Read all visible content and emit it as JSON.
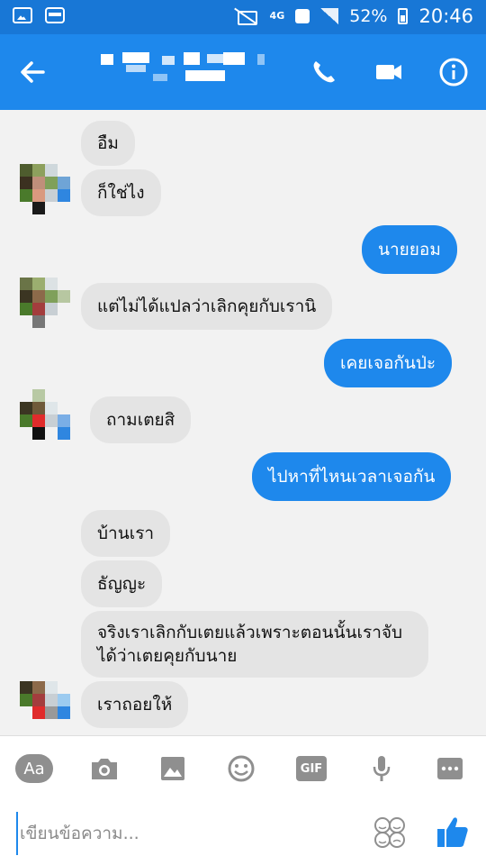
{
  "status_bar": {
    "network": "4G",
    "battery": "52%",
    "time": "20:46"
  },
  "header": {
    "back_icon": "arrow-left-icon",
    "call_icon": "phone-icon",
    "video_icon": "video-camera-icon",
    "info_icon": "info-icon"
  },
  "messages": [
    {
      "side": "in",
      "text": "อืม"
    },
    {
      "side": "in",
      "text": "ก็ใช่ไง"
    },
    {
      "side": "out",
      "text": "นายยอม"
    },
    {
      "side": "in",
      "text": "แต่ไม่ได้แปลว่าเลิกคุยกับเรานิ"
    },
    {
      "side": "out",
      "text": "เคยเจอกันป่ะ"
    },
    {
      "side": "in",
      "text": "ถามเตยสิ"
    },
    {
      "side": "out",
      "text": "ไปหาที่ไหนเวลาเจอกัน"
    },
    {
      "side": "in",
      "text": "บ้านเรา"
    },
    {
      "side": "in",
      "text": "ธัญญะ"
    },
    {
      "side": "in",
      "text": "จริงเราเลิกกับเตยแล้วเพราะตอนนั้นเราจับ"
    },
    {
      "side": "in",
      "text": "ได้ว่าเตยคุยกับนาย"
    },
    {
      "side": "in",
      "text": "เราถอยให้"
    }
  ],
  "composer": {
    "aa_label": "Aa",
    "gif_label": "GIF",
    "placeholder": "เขียนข้อความ..."
  },
  "colors": {
    "brand": "#1e88ec",
    "status_bar": "#1877d6",
    "incoming_bubble": "#e4e4e4",
    "icon_gray": "#8f8f8f"
  }
}
